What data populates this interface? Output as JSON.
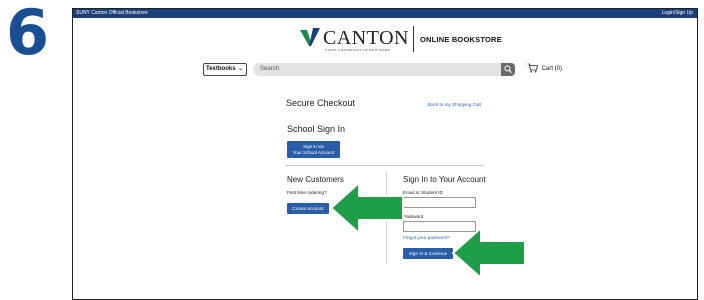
{
  "step_number": "6",
  "topbar": {
    "site_label": "SUNY Canton Official Bookstore",
    "login_label": "Login/Sign Up"
  },
  "header": {
    "logo_text": "CANTON",
    "logo_subtext": "STATE UNIVERSITY OF NEW YORK",
    "store_label": "ONLINE BOOKSTORE"
  },
  "search": {
    "department_value": "Textbooks",
    "placeholder": "Search",
    "cart_label": "Cart (0)"
  },
  "checkout": {
    "title": "Secure Checkout",
    "back_link": "Back to my Shopping Cart",
    "school_title": "School Sign In",
    "school_button_line1": "Sign in via",
    "school_button_line2": "Your School Account",
    "new_title": "New Customers",
    "first_time_label": "First time ordering?",
    "create_button": "Create Account",
    "signin_title": "Sign In to Your Account",
    "email_label": "Email or Student ID",
    "email_value": "",
    "password_label": "Password",
    "password_value": "",
    "forgot_link": "Forgot your password?",
    "signin_button": "Sign In & Continue"
  },
  "colors": {
    "step_blue": "#1a4f95",
    "topbar": "#1a3f7a",
    "button_blue": "#2a5da8",
    "link_blue": "#2d63b8",
    "arrow_green": "#1f9e4a",
    "logo_green": "#1e8a4c",
    "logo_navy": "#1a3f7a"
  },
  "icons": {
    "search": "search-icon",
    "cart": "cart-icon",
    "dropdown": "chevron-down-icon",
    "annotation": "arrow-left-icon"
  }
}
